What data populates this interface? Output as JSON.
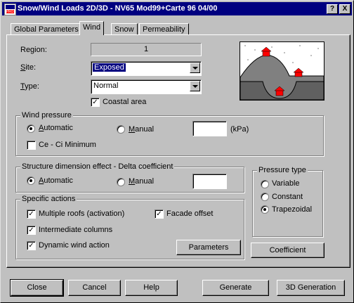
{
  "window": {
    "title": "Snow/Wind Loads 2D/3D - NV65 Mod99+Carte 96 04/00",
    "help_button": "?",
    "close_button": "X"
  },
  "tabs": [
    {
      "label": "Global Parameters",
      "active": false
    },
    {
      "label": "Wind",
      "active": true
    },
    {
      "label": "Snow",
      "active": false
    },
    {
      "label": "Permeability",
      "active": false
    }
  ],
  "region": {
    "label": "Region:",
    "value": "1"
  },
  "site": {
    "label": "Site:",
    "value": "Exposed"
  },
  "type": {
    "label": "Type:",
    "value": "Normal"
  },
  "coastal": {
    "label": "Coastal area",
    "checked": true
  },
  "wind_pressure": {
    "legend": "Wind pressure",
    "automatic": "Automatic",
    "manual": "Manual",
    "value": "",
    "unit": "(kPa)",
    "ce_ci": "Ce - Ci Minimum"
  },
  "structure_effect": {
    "legend": "Structure dimension effect - Delta coefficient",
    "automatic": "Automatic",
    "manual": "Manual",
    "value": ""
  },
  "pressure_type": {
    "legend": "Pressure type",
    "variable": "Variable",
    "constant": "Constant",
    "trapezoidal": "Trapezoidal"
  },
  "specific_actions": {
    "legend": "Specific actions",
    "multiple_roofs": "Multiple roofs (activation)",
    "facade_offset": "Facade offset",
    "intermediate_columns": "Intermediate columns",
    "dynamic_wind": "Dynamic wind action",
    "parameters_button": "Parameters"
  },
  "coefficient_button": "Coefficient",
  "footer": {
    "close": "Close",
    "cancel": "Cancel",
    "help": "Help",
    "generate": "Generate",
    "generation_3d": "3D Generation"
  },
  "colors": {
    "title_bar": "#000080",
    "dialog_bg": "#c0c0c0",
    "sky": "#ffffff",
    "hill": "#808080",
    "house": "#ff0000"
  }
}
